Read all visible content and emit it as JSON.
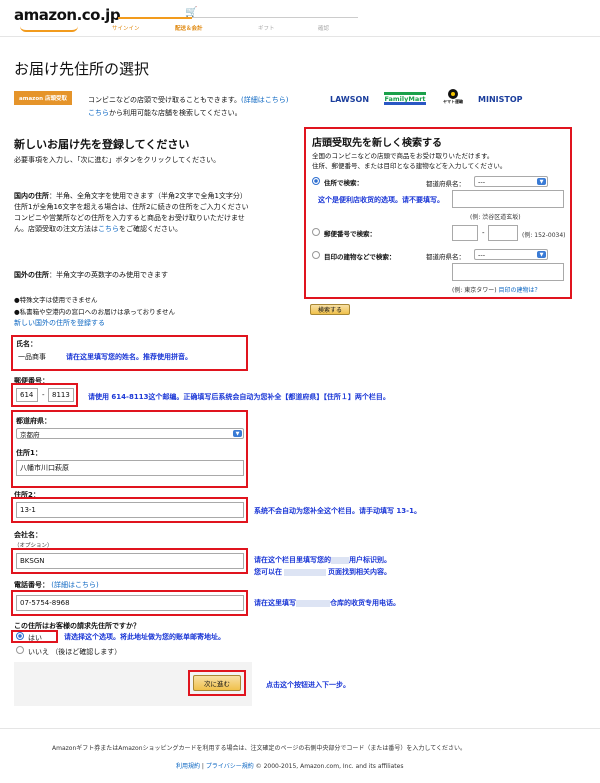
{
  "header": {
    "logo": "amazon.co.jp",
    "steps": [
      "サインイン",
      "配送＆会計",
      "ギフト",
      "確認"
    ]
  },
  "page_title": "お届け先住所の選択",
  "store_pickup": {
    "badge": "amazon 店頭受取",
    "line1": "コンビニなどの店頭で受け取ることもできます。",
    "line1_link": "(詳細はこちら)",
    "line2_link": "こちら",
    "line2_rest": "から利用可能な店舗を検索してください。",
    "stores": [
      "LAWSON",
      "FamilyMart",
      "ヤマト運輸",
      "MINISTOP"
    ]
  },
  "new_address": {
    "title": "新しいお届け先を登録してください",
    "intro": "必要事項を入力し、「次に進む」ボタンをクリックしてください。",
    "domestic_label": "国内の住所",
    "domestic_text": "：半角、全角文字を使用できます（半角2文字で全角1文字分）",
    "note_line2": "住所1が全角16文字を超える場合は、住所2に続きの住所をご入力ください",
    "note_line3": "コンビニや営業所などの住所を入力すると商品をお受け取りいただけません。店頭受取の注文方法は",
    "note_link": "こちら",
    "note_line3_end": "をご確認ください。",
    "foreign_label": "国外の住所",
    "foreign_text": "：半角文字の英数字のみ使用できます",
    "bullet1": "●特殊文字は使用できません",
    "bullet2": "●私書箱や空港内の窓口へのお届けは承っておりません",
    "foreign_link": "新しい国外の住所を登録する"
  },
  "form": {
    "name_label": "氏名：",
    "name_value": "一品商事",
    "postal_label": "郵便番号：",
    "postal1": "614",
    "postal2": "8113",
    "pref_label": "都道府県：",
    "pref_value": "京都府",
    "addr1_label": "住所1：",
    "addr1_value": "八幡市川口萩原",
    "addr2_label": "住所2：",
    "addr2_value": "13-1",
    "company_label": "会社名：",
    "company_optional": "（オプション）",
    "company_value": "BKSGN",
    "phone_label": "電話番号：",
    "phone_link": "(詳細はこちら)",
    "phone_value": "07-5754-8968",
    "billing_q": "この住所はお客様の請求先住所ですか？",
    "yes": "はい",
    "no": "いいえ （後ほど確認します）",
    "next_button": "次に進む"
  },
  "pickup_search": {
    "title": "店頭受取先を新しく検索する",
    "desc1": "全国のコンビニなどの店頭で商品をお受け取りいただけます。",
    "desc2": "住所、郵便番号、または目印となる建物などを入力してください。",
    "opt1_label": "住所で検索：",
    "pref_label": "都道府県名：",
    "pref_value": "---",
    "opt1_example": "(例: 渋谷区道玄坂)",
    "opt2_label": "郵便番号で検索：",
    "opt2_example": "(例: 152-0034)",
    "opt3_label": "目印の建物などで検索：",
    "opt3_example": "(例: 東京タワー)",
    "opt3_link": "目印の建物は？",
    "search_button": "検索する"
  },
  "annotations": {
    "pickup_note": "这个是便利店收货的选项。请不要填写。",
    "name_note": "请在这里填写您的姓名。推荐使用拼音。",
    "postal_note": "请使用 614-8113这个邮编。正确填写后系统会自动为您补全【都道府県】【住所１】两个栏目。",
    "addr2_note": "系统不会自动为您补全这个栏目。请手动填写 13-1。",
    "company_note1": "请在这个栏目里填写您的",
    "company_note1_end": "用户标识别。",
    "company_note2": "您可以在",
    "company_note2_end": "页面找到相关内容。",
    "phone_note": "请在这里填写",
    "phone_note_end": "仓库的收货专用电话。",
    "billing_note": "请选择这个选项。将此地址做为您的账单邮寄地址。",
    "next_note": "点击这个按钮进入下一步。"
  },
  "footer": {
    "text": "Amazonギフト券またはAmazonショッピングカードを利用する場合は、注文確定のページの右側中央部分でコード（または番号）を入力してください。",
    "terms": "利用規約",
    "privacy": "プライバシー規約",
    "copyright": "© 2000-2015, Amazon.com, Inc. and its affiliates"
  }
}
